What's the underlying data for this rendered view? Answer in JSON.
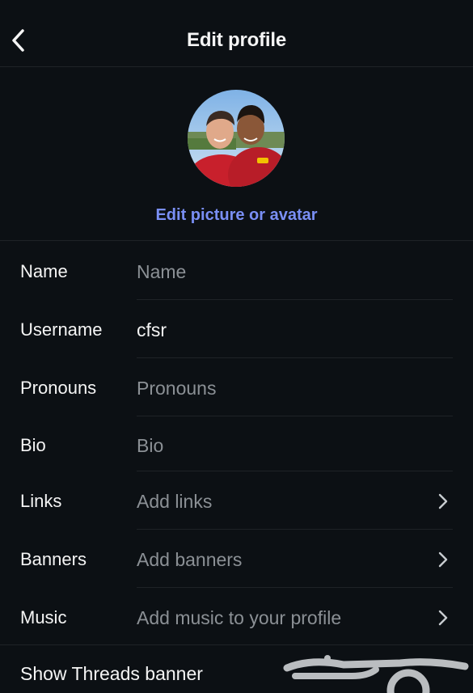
{
  "header": {
    "title": "Edit profile",
    "back_icon": "chevron-left-icon"
  },
  "avatar": {
    "edit_label": "Edit picture or avatar"
  },
  "fields": [
    {
      "label": "Name",
      "value": "Name",
      "filled": false
    },
    {
      "label": "Username",
      "value": "cfsr",
      "filled": true
    },
    {
      "label": "Pronouns",
      "value": "Pronouns",
      "filled": false
    },
    {
      "label": "Bio",
      "value": "Bio",
      "filled": false
    },
    {
      "label": "Links",
      "value": "Add links",
      "filled": false,
      "chevron": true
    },
    {
      "label": "Banners",
      "value": "Add banners",
      "filled": false,
      "chevron": true
    },
    {
      "label": "Music",
      "value": "Add music to your profile",
      "filled": false,
      "chevron": true
    }
  ],
  "threads_banner": {
    "label": "Show Threads banner"
  },
  "watermark": {
    "text": "حراج"
  },
  "colors": {
    "background": "#0c1014",
    "accent": "#7a8ff5",
    "placeholder": "#8b9095",
    "divider": "#1f2327"
  }
}
